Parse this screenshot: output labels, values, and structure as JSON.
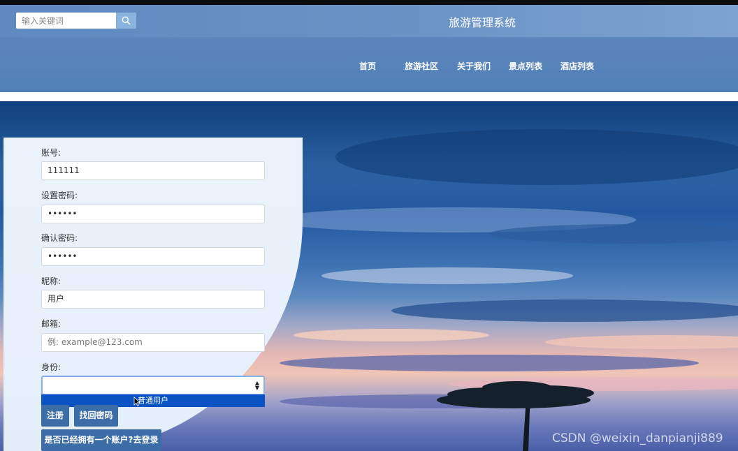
{
  "header": {
    "search_placeholder": "输入关键词",
    "title": "旅游管理系统"
  },
  "nav": {
    "items": [
      {
        "label": "首页"
      },
      {
        "label": "旅游社区"
      },
      {
        "label": "关于我们"
      },
      {
        "label": "景点列表"
      },
      {
        "label": "酒店列表"
      }
    ]
  },
  "form": {
    "account_label": "账号:",
    "account_value": "111111",
    "password_label": "设置密码:",
    "password_value": "••••••",
    "confirm_label": "确认密码:",
    "confirm_value": "••••••",
    "nickname_label": "昵称:",
    "nickname_value": "用户",
    "email_label": "邮箱:",
    "email_placeholder": "例: example@123.com",
    "identity_label": "身份:",
    "identity_value": "",
    "identity_option": "普通用户",
    "register_button": "注册",
    "recover_button": "找回密码",
    "login_link_button": "是否已经拥有一个账户?去登录"
  },
  "watermark": "CSDN @weixin_danpianji889",
  "colors": {
    "header_bg": "#5c86bb",
    "button_bg": "#3c6da6",
    "option_highlight": "#0a53c4",
    "panel_bg": "#e8f1fb"
  }
}
